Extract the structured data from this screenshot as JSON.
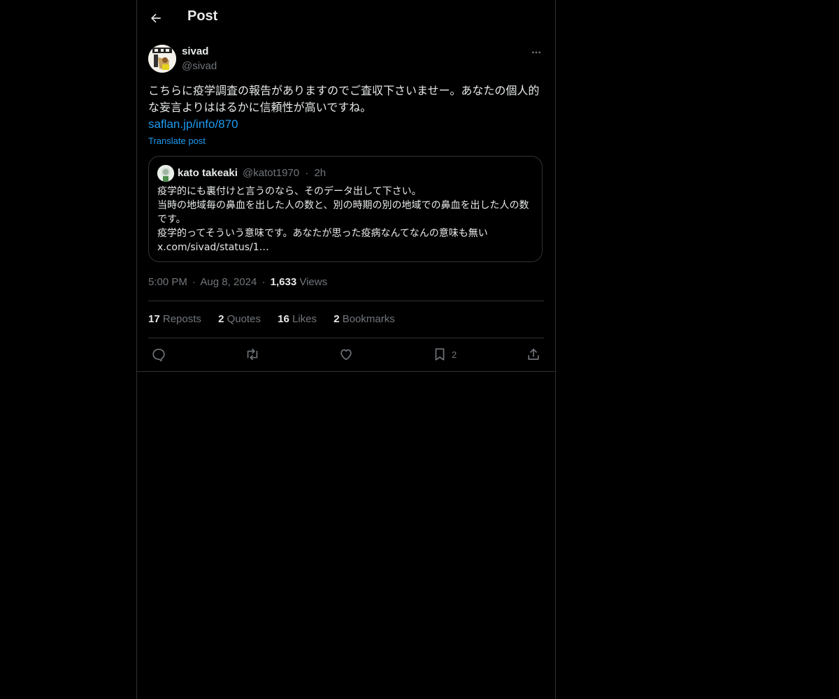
{
  "header": {
    "title": "Post"
  },
  "author": {
    "name": "sivad",
    "handle": "@sivad"
  },
  "post": {
    "text": "こちらに疫学調査の報告がありますのでご査収下さいませー。あなたの個人的な妄言よりははるかに信頼性が高いですね。",
    "link": "saflan.jp/info/870",
    "translate_label": "Translate post"
  },
  "quote": {
    "name": "kato takeaki",
    "handle": "@katot1970",
    "separator": "·",
    "time": "2h",
    "text": "疫学的にも裏付けと言うのなら、そのデータ出して下さい。\n当時の地域毎の鼻血を出した人の数と、別の時期の別の地域での鼻血を出した人の数です。\n疫学的ってそういう意味です。あなたが思った疫病なんてなんの意味も無い\nx.com/sivad/status/1…"
  },
  "meta": {
    "time": "5:00 PM",
    "separator": "·",
    "date": "Aug 8, 2024",
    "views_count": "1,633",
    "views_label": "Views"
  },
  "stats": {
    "reposts_count": "17",
    "reposts_label": "Reposts",
    "quotes_count": "2",
    "quotes_label": "Quotes",
    "likes_count": "16",
    "likes_label": "Likes",
    "bookmarks_count": "2",
    "bookmarks_label": "Bookmarks"
  },
  "actions": {
    "icons": [
      "reply-icon",
      "repost-icon",
      "like-icon",
      "bookmark-icon",
      "share-icon"
    ],
    "bookmark_count": "2"
  },
  "colors": {
    "background": "#000000",
    "text": "#e7e9ea",
    "muted": "#71767b",
    "link": "#1d9bf0",
    "border": "#2f3336"
  }
}
